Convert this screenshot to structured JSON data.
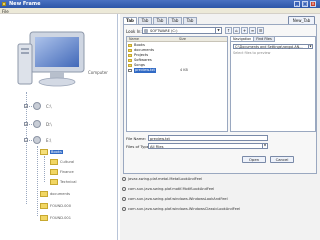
{
  "window": {
    "title": "New Frame"
  },
  "menu": {
    "file_label": "File"
  },
  "tree": {
    "computer_label": "Computer",
    "drives": [
      "C:\\",
      "D:\\",
      "E:\\"
    ],
    "folders": [
      {
        "label": "Books"
      },
      {
        "label": "Cultural"
      },
      {
        "label": "Finance"
      },
      {
        "label": "Technical"
      },
      {
        "label": "documents"
      },
      {
        "label": "FOUND.000"
      },
      {
        "label": "FOUND.001"
      }
    ]
  },
  "tabs": [
    "Tab",
    "Tab",
    "Tab",
    "Tab",
    "Tab"
  ],
  "new_tab_label": "New_Tab",
  "chooser": {
    "look_in_label": "Look In:",
    "look_in_value": "SOFTWARE (C:)",
    "columns": {
      "name": "Name",
      "size": "Size"
    },
    "files": [
      {
        "name": "Books",
        "size": ""
      },
      {
        "name": "documents",
        "size": ""
      },
      {
        "name": "Projects",
        "size": ""
      },
      {
        "name": "Softwares",
        "size": ""
      },
      {
        "name": "Songs",
        "size": ""
      },
      {
        "name": "preview.txt",
        "size": "4 KB"
      }
    ],
    "preview_tabs": [
      "Navigation",
      "Find Files"
    ],
    "preview_combo_value": "C:\\Documents and Settings\\rangol.AN...",
    "preview_text": "Select files to preview",
    "file_name_label": "File Name:",
    "file_name_value": "preview.txt",
    "file_type_label": "Files of Type:",
    "file_type_value": "All Files",
    "open_label": "Open",
    "cancel_label": "Cancel"
  },
  "look_and_feels": [
    "javax.swing.plaf.metal.MetalLookAndFeel",
    "com.sun.java.swing.plaf.motif.MotifLookAndFeel",
    "com.sun.java.swing.plaf.windows.WindowsLookAndFeel",
    "com.sun.java.swing.plaf.windows.WindowsClassicLookAndFeel"
  ]
}
